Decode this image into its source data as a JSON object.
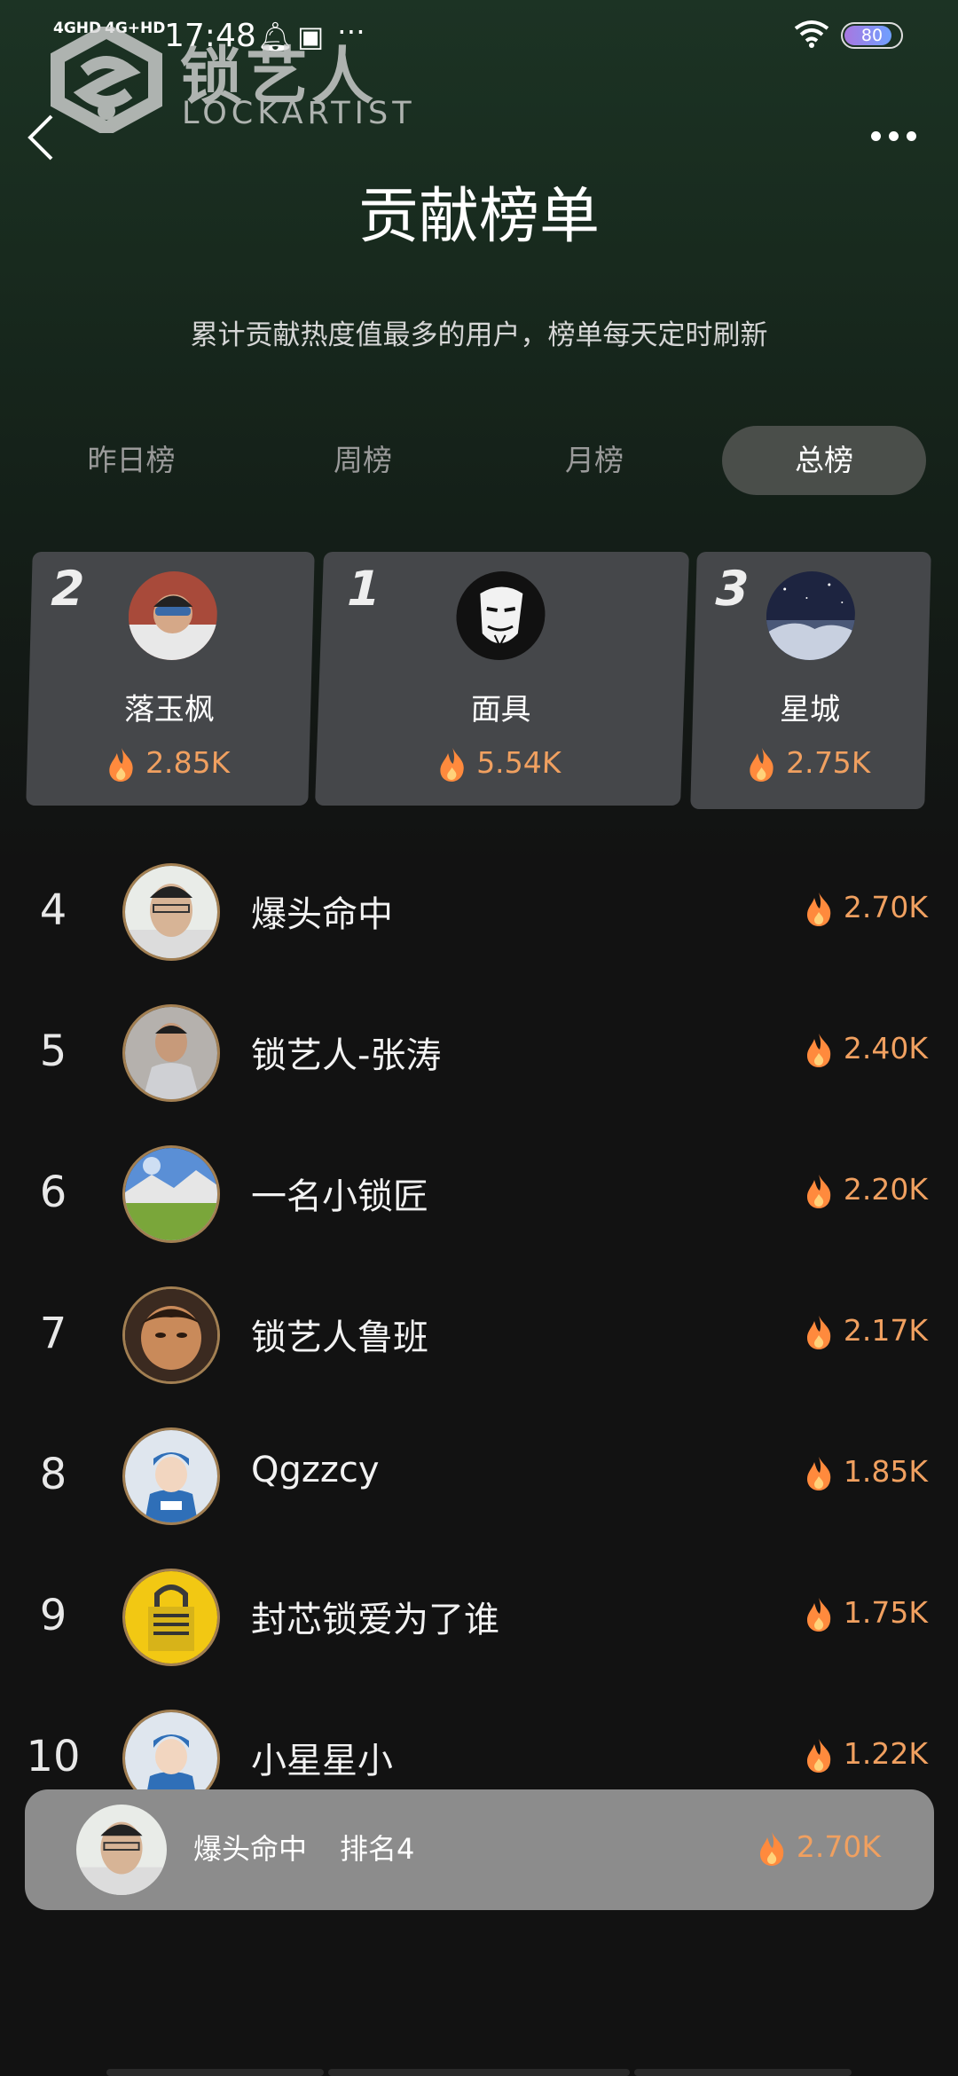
{
  "status_bar": {
    "net1": "4GHD",
    "net2": "4G+HD",
    "time": "17:48",
    "battery": "80"
  },
  "logo": {
    "cn": "锁艺人",
    "en": "LOCKARTIST"
  },
  "title": "贡献榜单",
  "subtitle": "累计贡献热度值最多的用户，榜单每天定时刷新",
  "tabs": [
    {
      "label": "昨日榜",
      "active": false
    },
    {
      "label": "周榜",
      "active": false
    },
    {
      "label": "月榜",
      "active": false
    },
    {
      "label": "总榜",
      "active": true
    }
  ],
  "podium": [
    {
      "rank": "2",
      "name": "落玉枫",
      "score": "2.85K"
    },
    {
      "rank": "1",
      "name": "面具",
      "score": "5.54K"
    },
    {
      "rank": "3",
      "name": "星城",
      "score": "2.75K"
    }
  ],
  "list": [
    {
      "rank": "4",
      "name": "爆头命中",
      "score": "2.70K"
    },
    {
      "rank": "5",
      "name": "锁艺人-张涛",
      "score": "2.40K"
    },
    {
      "rank": "6",
      "name": "一名小锁匠",
      "score": "2.20K"
    },
    {
      "rank": "7",
      "name": "锁艺人鲁班",
      "score": "2.17K"
    },
    {
      "rank": "8",
      "name": "Qgzzcy",
      "score": "1.85K"
    },
    {
      "rank": "9",
      "name": "封芯锁爱为了谁",
      "score": "1.75K"
    },
    {
      "rank": "10",
      "name": "小星星小",
      "score": "1.22K"
    }
  ],
  "my_rank": {
    "name": "爆头命中",
    "rank_text": "排名4",
    "score": "2.70K"
  },
  "colors": {
    "accent": "#f0a060",
    "tab_active_bg": "#4a4e4a",
    "card_bg": "#45474a"
  }
}
